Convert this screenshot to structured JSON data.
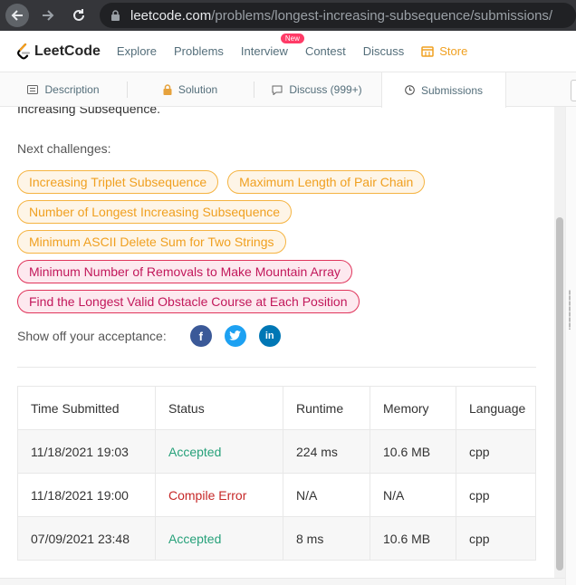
{
  "browser": {
    "url_domain": "leetcode.com",
    "url_path": "/problems/longest-increasing-subsequence/submissions/"
  },
  "nav": {
    "logo_text": "LeetCode",
    "items": [
      "Explore",
      "Problems",
      "Interview",
      "Contest",
      "Discuss"
    ],
    "new_badge": "New",
    "store": "Store"
  },
  "tabs": [
    {
      "label": "Description",
      "icon": "document-icon"
    },
    {
      "label": "Solution",
      "icon": "lock-icon"
    },
    {
      "label": "Discuss (999+)",
      "icon": "comment-icon"
    },
    {
      "label": "Submissions",
      "icon": "clock-icon",
      "active": true
    }
  ],
  "content": {
    "clipped_text": "Increasing Subsequence.",
    "next_label": "Next challenges:",
    "challenges": [
      [
        {
          "label": "Increasing Triplet Subsequence",
          "difficulty": "medium"
        },
        {
          "label": "Maximum Length of Pair Chain",
          "difficulty": "medium"
        }
      ],
      [
        {
          "label": "Number of Longest Increasing Subsequence",
          "difficulty": "medium"
        }
      ],
      [
        {
          "label": "Minimum ASCII Delete Sum for Two Strings",
          "difficulty": "medium"
        }
      ],
      [
        {
          "label": "Minimum Number of Removals to Make Mountain Array",
          "difficulty": "hard"
        }
      ],
      [
        {
          "label": "Find the Longest Valid Obstacle Course at Each Position",
          "difficulty": "hard"
        }
      ]
    ],
    "share_label": "Show off your acceptance:",
    "social": [
      {
        "icon": "facebook-icon",
        "glyph": "f"
      },
      {
        "icon": "twitter-icon",
        "glyph": "🐦"
      },
      {
        "icon": "linkedin-icon",
        "glyph": "in"
      }
    ]
  },
  "table": {
    "headers": [
      "Time Submitted",
      "Status",
      "Runtime",
      "Memory",
      "Language"
    ],
    "rows": [
      [
        "11/18/2021 19:03",
        "Accepted",
        "224 ms",
        "10.6 MB",
        "cpp"
      ],
      [
        "11/18/2021 19:00",
        "Compile Error",
        "N/A",
        "N/A",
        "cpp"
      ],
      [
        "07/09/2021 23:48",
        "Accepted",
        "8 ms",
        "10.6 MB",
        "cpp"
      ]
    ]
  },
  "colors": {
    "accepted": "#27a17a",
    "error": "#c62828",
    "medium": "#f0a020",
    "hard": "#c2185b"
  }
}
